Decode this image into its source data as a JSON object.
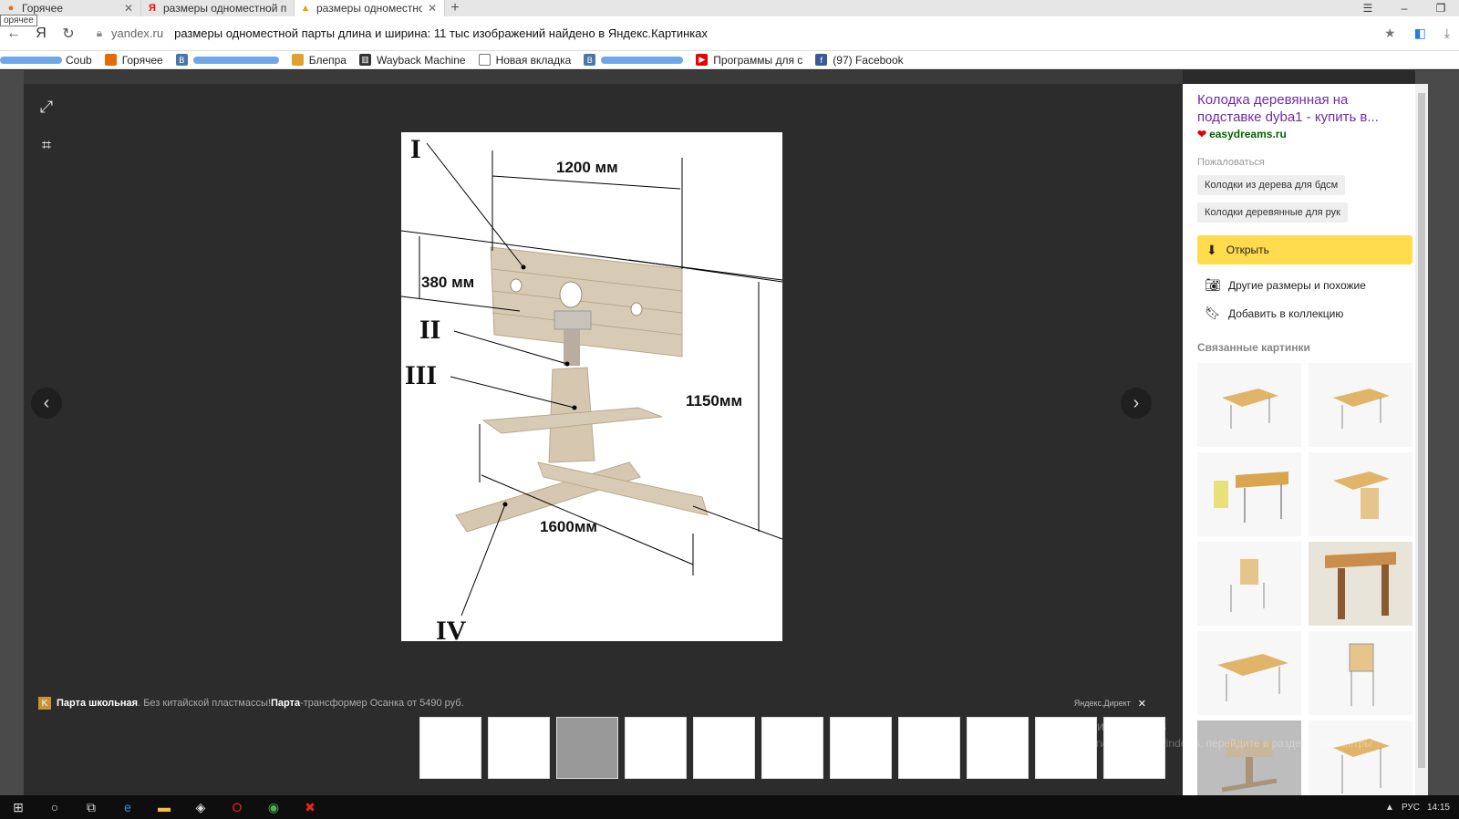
{
  "tabs": [
    {
      "label": "Горячее",
      "active": false
    },
    {
      "label": "размеры одноместной пар",
      "active": false
    },
    {
      "label": "размеры одноместной п",
      "active": true
    }
  ],
  "tooltip": "орячее",
  "address": {
    "domain": "yandex.ru",
    "title": "размеры одноместной парты длина и ширина: 11 тыс изображений найдено в Яндекс.Картинках"
  },
  "bookmarks": [
    "Coub",
    "Горячее",
    "Блепра",
    "Wayback Machine",
    "Новая вкладка",
    "Программы для с",
    "(97) Facebook"
  ],
  "photo": {
    "dim_width": "1200 мм",
    "dim_height_top": "380 мм",
    "dim_height": "1150мм",
    "dim_base": "1600мм",
    "roman_1": "I",
    "roman_2": "II",
    "roman_3": "III",
    "roman_4": "IV"
  },
  "ad": {
    "bold_title": "Парта школьная",
    "text1": ". Без китайской пластмассы! ",
    "bold2": "Парта",
    "text2": "-трансформер Осанка от 5490 руб.",
    "direct": "Яндекс.Директ"
  },
  "watermark": {
    "line1": "Активация Windows",
    "line2": "Чтобы активировать Windows, перейдите в раздел \"Параметры\"."
  },
  "panel": {
    "title": "Колодка деревянная на подставке dyba1 - купить в...",
    "site": "easydreams.ru",
    "complain": "Пожаловаться",
    "chips": [
      "Колодки из дерева для бдсм",
      "Колодки деревянные для рук"
    ],
    "open": "Открыть",
    "other_sizes": "Другие размеры и похожие",
    "add_collection": "Добавить в коллекцию",
    "related": "Связанные картинки"
  },
  "taskbar": {
    "lang": "РУС",
    "time": "14:15"
  }
}
